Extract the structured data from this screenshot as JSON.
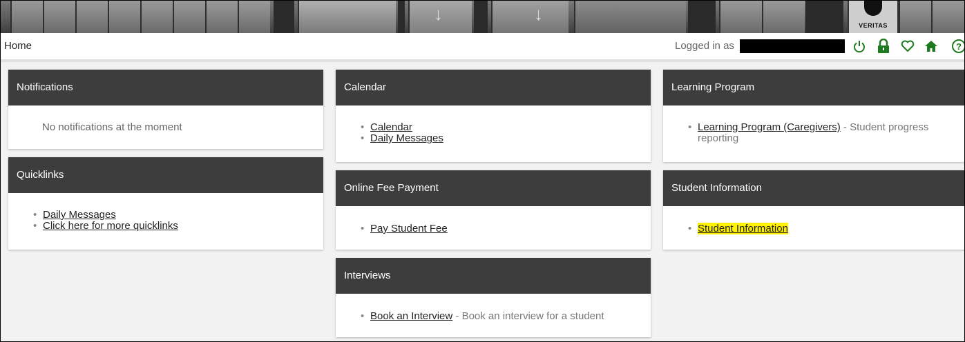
{
  "banner": {
    "logo_text": "VERITAS"
  },
  "topbar": {
    "breadcrumb": "Home",
    "logged_in_label": "Logged in as",
    "icons": [
      "power-icon",
      "lock-icon",
      "heart-icon",
      "home-icon",
      "help-icon"
    ],
    "icon_color": "#1e7a1e"
  },
  "cards": {
    "notifications": {
      "title": "Notifications",
      "empty": "No notifications at the moment"
    },
    "quicklinks": {
      "title": "Quicklinks",
      "links": [
        "Daily Messages",
        "Click here for more quicklinks"
      ]
    },
    "calendar": {
      "title": "Calendar",
      "links": [
        "Calendar",
        "Daily Messages"
      ]
    },
    "fee": {
      "title": "Online Fee Payment",
      "links": [
        "Pay Student Fee"
      ]
    },
    "interviews": {
      "title": "Interviews",
      "link": "Book an Interview",
      "desc": " - Book an interview for a student"
    },
    "learning": {
      "title": "Learning Program",
      "link": "Learning Program (Caregivers)",
      "desc": " - Student progress reporting"
    },
    "student": {
      "title": "Student Information",
      "link": "Student Information",
      "highlight_color": "#fff200"
    }
  }
}
